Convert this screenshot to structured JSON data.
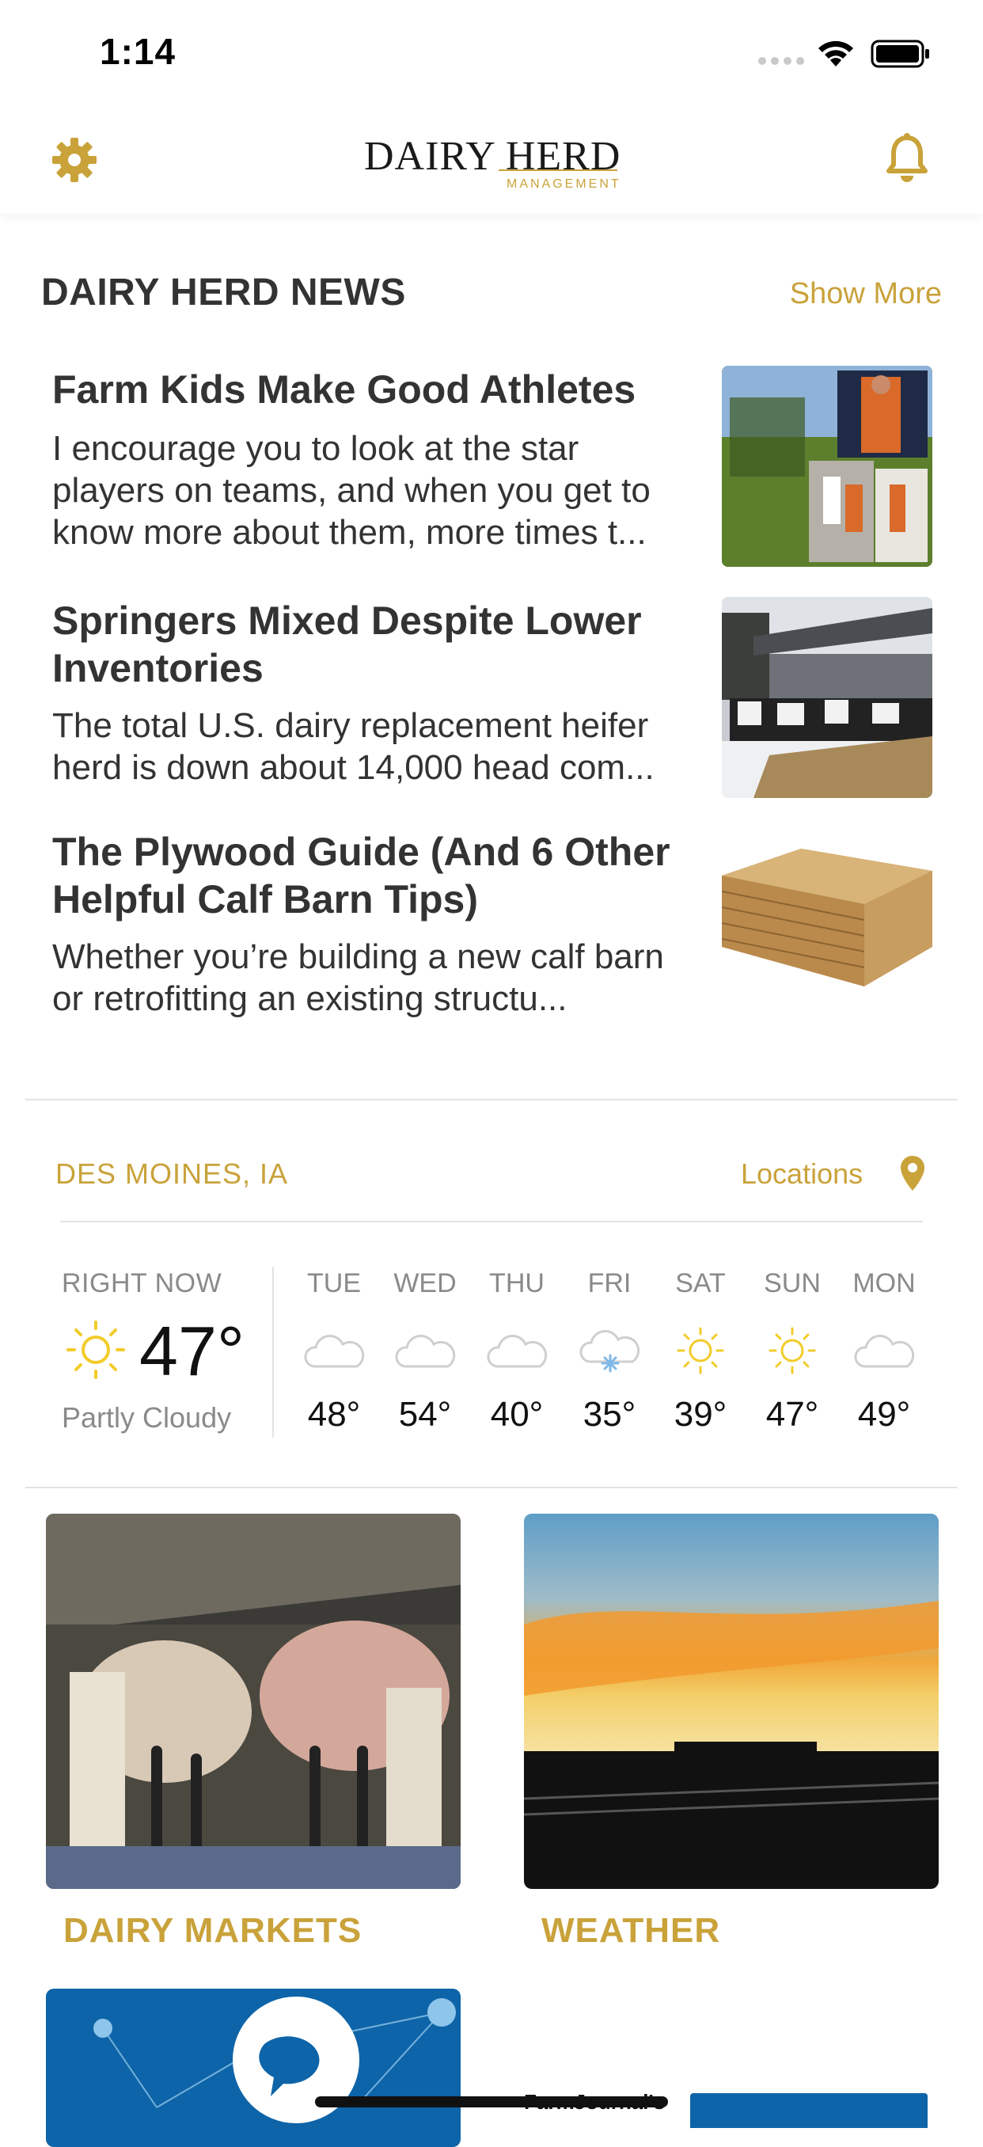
{
  "status_bar": {
    "time": "1:14"
  },
  "header": {
    "logo_main": "DAIRY HERD",
    "logo_sub": "MANAGEMENT"
  },
  "news": {
    "section_title": "DAIRY HERD NEWS",
    "show_more": "Show More",
    "articles": [
      {
        "title": "Farm Kids Make Good Athletes",
        "description": "I encourage you to look at the star players on teams, and when you get to know more about them, more times t..."
      },
      {
        "title": "Springers Mixed Despite Lower Inventories",
        "description": "The total U.S. dairy replacement heifer herd is down about 14,000 head com..."
      },
      {
        "title": "The Plywood Guide (And 6 Other Helpful Calf Barn Tips)",
        "description": "Whether you’re building a new calf barn or retrofitting an existing structu..."
      }
    ]
  },
  "weather": {
    "location": "DES MOINES, IA",
    "locations_label": "Locations",
    "now": {
      "label": "RIGHT NOW",
      "temp": "47°",
      "condition": "Partly Cloudy",
      "icon": "sun-icon"
    },
    "forecast": [
      {
        "day": "TUE",
        "temp": "48°",
        "icon": "cloud-icon"
      },
      {
        "day": "WED",
        "temp": "54°",
        "icon": "cloud-icon"
      },
      {
        "day": "THU",
        "temp": "40°",
        "icon": "cloud-icon"
      },
      {
        "day": "FRI",
        "temp": "35°",
        "icon": "snow-cloud-icon"
      },
      {
        "day": "SAT",
        "temp": "39°",
        "icon": "sun-icon"
      },
      {
        "day": "SUN",
        "temp": "47°",
        "icon": "sun-icon"
      },
      {
        "day": "MON",
        "temp": "49°",
        "icon": "cloud-icon"
      }
    ]
  },
  "tiles": [
    {
      "label": "DAIRY MARKETS"
    },
    {
      "label": "WEATHER"
    }
  ],
  "partial_text": "FarmJournal's",
  "colors": {
    "accent": "#c9a23a",
    "text": "#333333",
    "muted": "#8a8a8a",
    "divider": "#e3e3e3"
  }
}
